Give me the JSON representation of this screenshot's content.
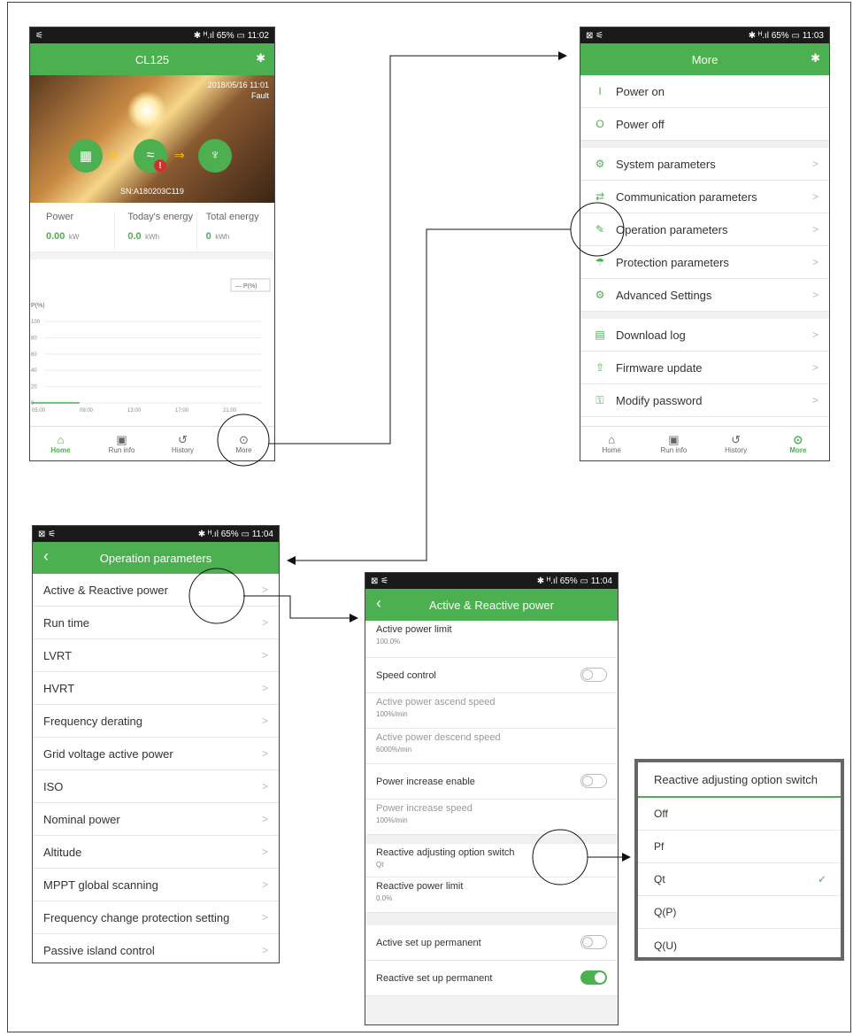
{
  "home": {
    "status": {
      "left": "⚟",
      "right": "✱ ᴴ.ıl 65% ▭ 11:02"
    },
    "title": "CL125",
    "bt_icon": "bluetooth-icon",
    "datetime": "2018/05/16 11:01",
    "fault": "Fault",
    "sn": "SN:A180203C119",
    "stats": [
      {
        "label": "Power",
        "value": "0.00",
        "unit": "kW"
      },
      {
        "label": "Today's energy",
        "value": "0.0",
        "unit": "kWh"
      },
      {
        "label": "Total energy",
        "value": "0",
        "unit": "kWh"
      }
    ],
    "chart": {
      "legend": "— P(%)",
      "ylabel": "P(%)",
      "yticks": [
        "100",
        "80",
        "60",
        "40",
        "20",
        "0"
      ],
      "xticks": [
        "05:00",
        "09:00",
        "13:00",
        "17:00",
        "21:00"
      ]
    },
    "nav": [
      "Home",
      "Run info",
      "History",
      "More"
    ]
  },
  "chart_data": {
    "type": "line",
    "series": [
      {
        "name": "P(%)",
        "x": [
          "05:00",
          "09:00",
          "13:00",
          "17:00",
          "21:00"
        ],
        "values": [
          0,
          0,
          null,
          null,
          null
        ]
      }
    ],
    "xlabel": "",
    "ylabel": "P(%)",
    "ylim": [
      0,
      100
    ]
  },
  "more": {
    "status": {
      "left": "⊠ ⚟",
      "right": "✱ ᴴ.ıl 65% ▭ 11:03"
    },
    "title": "More",
    "group1": [
      {
        "label": "Power on",
        "icon": "I"
      },
      {
        "label": "Power off",
        "icon": "O"
      }
    ],
    "group2": [
      {
        "label": "System parameters",
        "icon": "⚙"
      },
      {
        "label": "Communication parameters",
        "icon": "⇄"
      },
      {
        "label": "Operation parameters",
        "icon": "✎"
      },
      {
        "label": "Protection parameters",
        "icon": "☂"
      },
      {
        "label": "Advanced Settings",
        "icon": "⚙"
      }
    ],
    "group3": [
      {
        "label": "Download log",
        "icon": "▤"
      },
      {
        "label": "Firmware update",
        "icon": "⇧"
      },
      {
        "label": "Modify password",
        "icon": "⚿"
      }
    ],
    "nav": [
      "Home",
      "Run info",
      "History",
      "More"
    ]
  },
  "operation": {
    "status": {
      "left": "⊠ ⚟",
      "right": "✱ ᴴ.ıl 65% ▭ 11:04"
    },
    "title": "Operation parameters",
    "items": [
      "Active & Reactive power",
      "Run time",
      "LVRT",
      "HVRT",
      "Frequency derating",
      "Grid voltage active power",
      "ISO",
      "Nominal power",
      "Altitude",
      "MPPT global scanning",
      "Frequency change protection setting",
      "Passive island control"
    ]
  },
  "active": {
    "status": {
      "left": "⊠ ⚟",
      "right": "✱ ᴴ.ıl 65% ▭ 11:04"
    },
    "title": "Active & Reactive power",
    "limit": {
      "label": "Active power limit",
      "value": "100.0%"
    },
    "speed_control": {
      "label": "Speed control"
    },
    "ascend": {
      "label": "Active power ascend speed",
      "value": "100%/min"
    },
    "descend": {
      "label": "Active power descend speed",
      "value": "6000%/min"
    },
    "increase_enable": {
      "label": "Power increase enable"
    },
    "increase_speed": {
      "label": "Power increase speed",
      "value": "100%/min"
    },
    "reactive_switch": {
      "label": "Reactive adjusting option switch",
      "value": "Qt"
    },
    "reactive_limit": {
      "label": "Reactive power limit",
      "value": "0.0%"
    },
    "active_perm": {
      "label": "Active set up permanent"
    },
    "reactive_perm": {
      "label": "Reactive set up permanent"
    }
  },
  "popup": {
    "title": "Reactive adjusting option switch",
    "options": [
      "Off",
      "Pf",
      "Qt",
      "Q(P)",
      "Q(U)"
    ],
    "selected": "Qt"
  }
}
